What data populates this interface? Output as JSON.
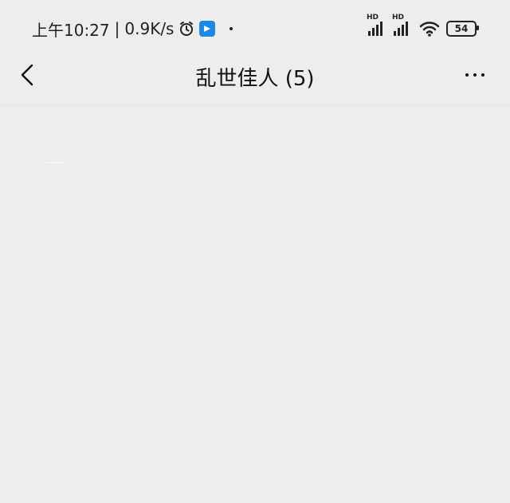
{
  "status_bar": {
    "time": "上午10:27",
    "separator": "|",
    "speed": "0.9K/s",
    "battery_level": "54",
    "icons": [
      "alarm-icon",
      "app-notification-icon",
      "dot-icon",
      "signal-hd-1-icon",
      "signal-hd-2-icon",
      "wifi-icon",
      "battery-icon"
    ]
  },
  "nav": {
    "title": "乱世佳人 (5)",
    "back_icon": "chevron-left-icon",
    "more_icon": "more-horizontal-icon"
  },
  "colors": {
    "background": "#ededed",
    "text": "#111111",
    "faint": "#f6f6f6",
    "accent": "#1e88e5"
  },
  "content": {
    "faint_lines": [
      "",
      "",
      ""
    ]
  }
}
